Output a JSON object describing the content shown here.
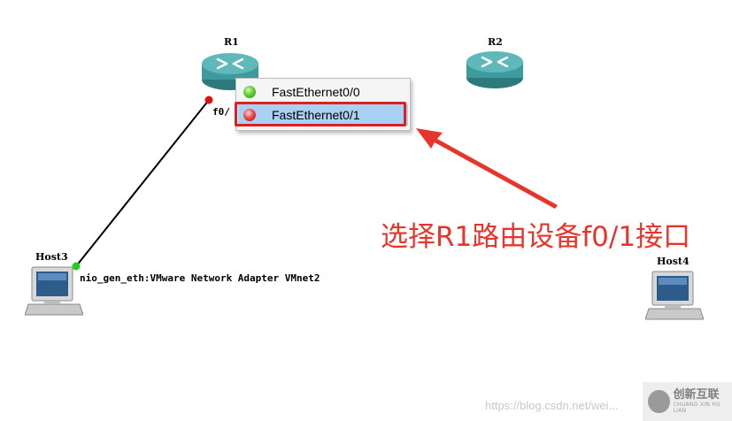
{
  "topology": {
    "routers": [
      {
        "name": "R1"
      },
      {
        "name": "R2"
      }
    ],
    "hosts": [
      {
        "name": "Host3",
        "interface_label": "nio_gen_eth:VMware Network Adapter VMnet2"
      },
      {
        "name": "Host4"
      }
    ],
    "link_port_label": "f0/",
    "colors": {
      "router": "#3e9a9c",
      "link": "#000000",
      "port_down": "#e01010",
      "port_up": "#22cc22"
    }
  },
  "context_menu": {
    "items": [
      {
        "label": "FastEthernet0/0",
        "status": "green"
      },
      {
        "label": "FastEthernet0/1",
        "status": "red",
        "selected": true
      }
    ]
  },
  "annotation": {
    "text": "选择R1路由设备f0/1接口",
    "color": "#e8352b"
  },
  "watermark": {
    "url": "https://blog.csdn.net/wei...",
    "brand": "创新互联",
    "brand_sub": "CHUANG XIN HU LIAN"
  }
}
